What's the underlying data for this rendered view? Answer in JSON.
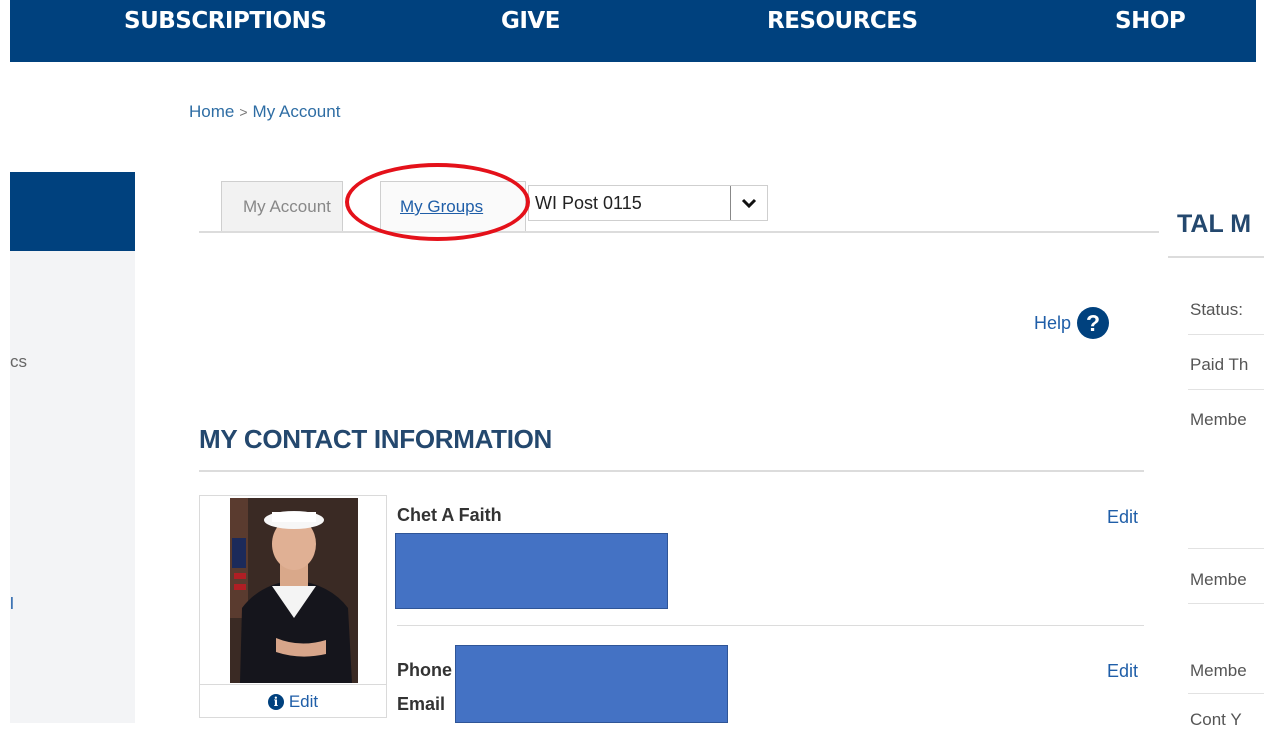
{
  "topnav": {
    "items": [
      {
        "label": "SUBSCRIPTIONS"
      },
      {
        "label": "GIVE"
      },
      {
        "label": "RESOURCES"
      },
      {
        "label": "SHOP"
      }
    ]
  },
  "breadcrumb": {
    "home": "Home",
    "separator": ">",
    "current": "My Account"
  },
  "sidebar": {
    "fragment_1": "cs",
    "fragment_2": "l"
  },
  "tabs": {
    "my_account": "My Account",
    "my_groups": "My Groups",
    "group_select_value": "WI Post 0115"
  },
  "help": {
    "label": "Help",
    "icon_glyph": "?"
  },
  "contact": {
    "section_title": "MY CONTACT INFORMATION",
    "name": "Chet A Faith",
    "edit_label": "Edit",
    "phone_label": "Phone",
    "email_label": "Email",
    "photo_edit_label": "Edit"
  },
  "right_panel": {
    "title_fragment": "TAL M",
    "rows": [
      "Status:",
      "Paid Th",
      "Membe",
      "Membe",
      "Membe",
      "Cont Y"
    ]
  },
  "colors": {
    "brand_navy": "#00417e",
    "link_blue": "#1f5ea8",
    "redaction": "#4472c4",
    "annotation_red": "#e4111a"
  }
}
